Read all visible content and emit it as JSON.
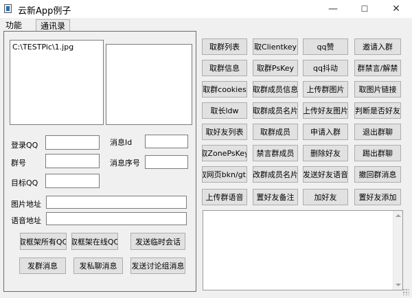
{
  "window": {
    "title": "云新App例子",
    "minimize_glyph": "—",
    "maximize_glyph": "☐",
    "close_glyph": "✕"
  },
  "tabs": [
    {
      "label": "功能"
    },
    {
      "label": "通讯录"
    }
  ],
  "left": {
    "picture_list": {
      "items": [
        "C:\\TESTPic\\1.jpg"
      ]
    },
    "labels": {
      "login_qq": "登录QQ",
      "group_no": "群号",
      "target_qq": "目标QQ",
      "message_id": "消息Id",
      "message_seq": "消息序号",
      "image_path": "图片地址",
      "voice_path": "语音地址"
    },
    "buttons": {
      "frame_all_qq": "取框架所有QQ",
      "frame_online_qq": "取框架在线QQ",
      "send_temp_chat": "发送临时会话",
      "send_group_msg": "发群消息",
      "send_private_msg": "发私聊消息",
      "send_discussion_msg": "发送讨论组消息"
    }
  },
  "right": {
    "buttons": [
      "取群列表",
      "取Clientkey",
      "qq赞",
      "邀请入群",
      "取群信息",
      "取群PsKey",
      "qq抖动",
      "群禁言/解禁",
      "取群cookies",
      "取群成员信息",
      "上传群图片",
      "取图片链接",
      "取长ldw",
      "取群成员名片",
      "上传好友图片",
      "判断是否好友",
      "取好友列表",
      "取群成员",
      "申请入群",
      "退出群聊",
      "取ZonePsKey",
      "禁言群成员",
      "删除好友",
      "踢出群聊",
      "取网页bkn/gtk",
      "改群成员名片",
      "发送好友语音",
      "撤回群消息",
      "上传群语音",
      "置好友备注",
      "加好友",
      "置好友添加"
    ]
  }
}
